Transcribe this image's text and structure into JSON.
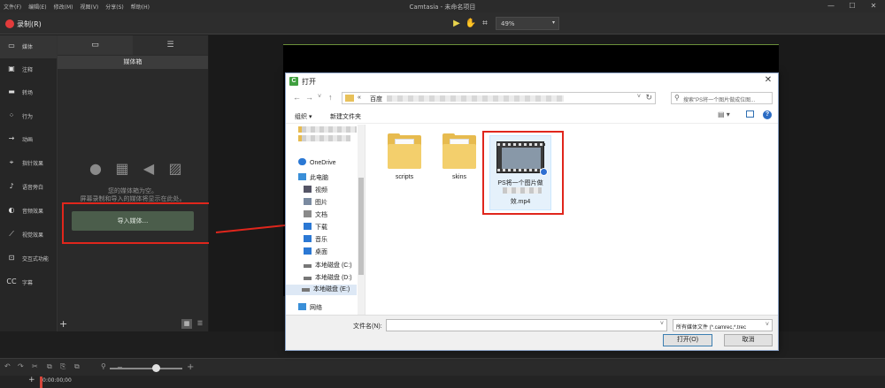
{
  "menu": [
    "文件(F)",
    "编辑(E)",
    "修改(M)",
    "视图(V)",
    "分享(S)",
    "帮助(H)"
  ],
  "app_title": "Camtasia - 未命名项目",
  "window_controls": {
    "minimize": "—",
    "maximize": "☐",
    "close": "✕"
  },
  "toolbar": {
    "record_label": "录制(R)",
    "zoom_value": "49%",
    "select_tool": "▶",
    "pan_tool": "✋",
    "crop_tool": "⌗",
    "dropdown": "▾"
  },
  "left_nav": [
    {
      "label": "媒体",
      "icon": "film-icon",
      "glyph": "▭"
    },
    {
      "label": "注释",
      "icon": "annotation-icon",
      "glyph": "▣"
    },
    {
      "label": "转场",
      "icon": "transition-icon",
      "glyph": "▬"
    },
    {
      "label": "行为",
      "icon": "behavior-icon",
      "glyph": "⁘"
    },
    {
      "label": "动画",
      "icon": "animation-icon",
      "glyph": "→"
    },
    {
      "label": "指针效果",
      "icon": "cursor-icon",
      "glyph": "⌖"
    },
    {
      "label": "语音旁白",
      "icon": "microphone-icon",
      "glyph": "♪"
    },
    {
      "label": "音频效果",
      "icon": "speaker-icon",
      "glyph": "◐"
    },
    {
      "label": "视觉效果",
      "icon": "wand-icon",
      "glyph": "⟋"
    },
    {
      "label": "交互式功能",
      "icon": "interactive-icon",
      "glyph": "⊡"
    },
    {
      "label": "字幕",
      "icon": "captions-icon",
      "glyph": "CC"
    }
  ],
  "bin": {
    "title": "媒体箱",
    "empty_line1": "您的媒体箱为空。",
    "empty_line2": "屏幕录制和导入的媒体将显示在此处。",
    "import_label": "导入媒体...",
    "add": "+",
    "tab1_glyph": "▭",
    "tab2_glyph": "☰",
    "view_grid": "▦",
    "view_list": "☰",
    "icons": [
      "●",
      "▦",
      "◀",
      "▨"
    ]
  },
  "timeline": {
    "time": "0:00:00;00",
    "undo": "↶",
    "redo": "↷",
    "cut": "✂",
    "copy": "⧉",
    "paste": "⎘",
    "zoom_out": "−",
    "zoom_in": "+",
    "magnifier": "⚲",
    "add": "+"
  },
  "dialog": {
    "title": "打开",
    "app_icon": "C",
    "close": "✕",
    "back": "←",
    "forward": "→",
    "up": "↑",
    "recent": "˅",
    "address_prefix": "«",
    "address_crumb": "百度",
    "address_dd": "˅",
    "refresh": "↻",
    "search_placeholder": "搜索\"PS将一个图片做成位图...",
    "search_glyph": "⚲",
    "organize": "组织 ▾",
    "new_folder": "新建文件夹",
    "view_glyph": "▤ ▾",
    "help": "?",
    "nav_items": [
      {
        "label": "OneDrive",
        "icon": "onedrive-icon",
        "color": "#2b78d4"
      },
      {
        "label": "此电脑",
        "icon": "computer-icon",
        "color": "#3a8fd8"
      },
      {
        "label": "视频",
        "icon": "video-folder-icon",
        "color": "#556"
      },
      {
        "label": "图片",
        "icon": "pictures-folder-icon",
        "color": "#556"
      },
      {
        "label": "文档",
        "icon": "documents-folder-icon",
        "color": "#556"
      },
      {
        "label": "下载",
        "icon": "download-icon",
        "color": "#2b78d4"
      },
      {
        "label": "音乐",
        "icon": "music-icon",
        "color": "#2b78d4"
      },
      {
        "label": "桌面",
        "icon": "desktop-icon",
        "color": "#2b78d4"
      },
      {
        "label": "本地磁盘 (C:)",
        "icon": "drive-icon",
        "color": "#777"
      },
      {
        "label": "本地磁盘 (D:)",
        "icon": "drive-icon",
        "color": "#777"
      },
      {
        "label": "本地磁盘 (E:)",
        "icon": "drive-icon",
        "color": "#777"
      },
      {
        "label": "网络",
        "icon": "network-icon",
        "color": "#3a8fd8"
      }
    ],
    "files": [
      {
        "name": "scripts",
        "type": "folder"
      },
      {
        "name": "skins",
        "type": "folder"
      }
    ],
    "video_file": {
      "name_line1": "PS将一个图片做",
      "name_line2": "效.mp4"
    },
    "filename_label": "文件名(N):",
    "filename_value": "",
    "filetype": "所有媒体文件 (*.camrec,*.trec",
    "open_label": "打开(O)",
    "cancel_label": "取消"
  },
  "colors": {
    "accent_red": "#e0261c",
    "record_red": "#e23b3b",
    "canvas_line": "#6b8f3a"
  }
}
